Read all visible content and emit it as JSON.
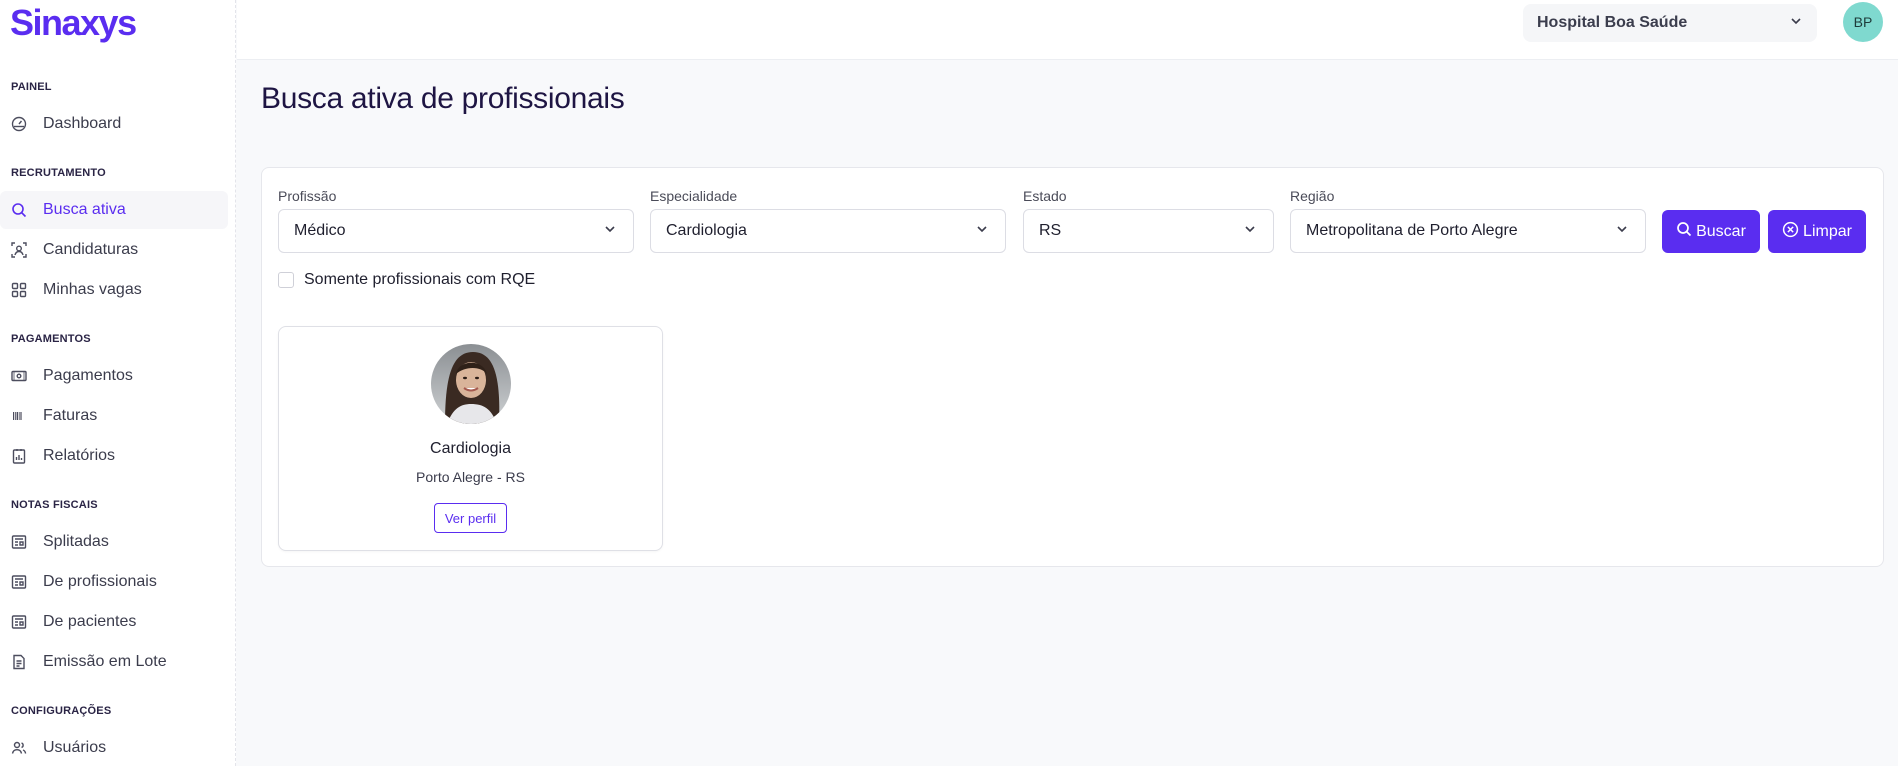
{
  "app": {
    "logo": "Sinaxys",
    "brand_color": "#5a2df0"
  },
  "sidebar": {
    "sections": [
      {
        "title": "PAINEL",
        "items": [
          {
            "label": "Dashboard",
            "icon": "dashboard-gauge-icon"
          }
        ]
      },
      {
        "title": "RECRUTAMENTO",
        "items": [
          {
            "label": "Busca ativa",
            "icon": "search-icon",
            "active": true
          },
          {
            "label": "Candidaturas",
            "icon": "candidates-icon"
          },
          {
            "label": "Minhas vagas",
            "icon": "grid-icon"
          }
        ]
      },
      {
        "title": "PAGAMENTOS",
        "items": [
          {
            "label": "Pagamentos",
            "icon": "cash-icon"
          },
          {
            "label": "Faturas",
            "icon": "barcode-icon"
          },
          {
            "label": "Relatórios",
            "icon": "report-icon"
          }
        ]
      },
      {
        "title": "NOTAS FISCAIS",
        "items": [
          {
            "label": "Splitadas",
            "icon": "newspaper-icon"
          },
          {
            "label": "De profissionais",
            "icon": "newspaper-icon"
          },
          {
            "label": "De pacientes",
            "icon": "newspaper-icon"
          },
          {
            "label": "Emissão em Lote",
            "icon": "document-icon"
          }
        ]
      },
      {
        "title": "CONFIGURAÇÕES",
        "items": [
          {
            "label": "Usuários",
            "icon": "users-icon"
          }
        ]
      }
    ]
  },
  "topbar": {
    "hospital": "Hospital Boa Saúde",
    "user_initials": "BP"
  },
  "main": {
    "title": "Busca ativa de profissionais",
    "filters": {
      "profissao": {
        "label": "Profissão",
        "value": "Médico"
      },
      "especialidade": {
        "label": "Especialidade",
        "value": "Cardiologia"
      },
      "estado": {
        "label": "Estado",
        "value": "RS"
      },
      "regiao": {
        "label": "Região",
        "value": "Metropolitana de Porto Alegre"
      }
    },
    "buttons": {
      "search": "Buscar",
      "clear": "Limpar"
    },
    "rqe_checkbox": {
      "label": "Somente profissionais com RQE",
      "checked": false
    },
    "results": [
      {
        "specialty": "Cardiologia",
        "location": "Porto Alegre - RS",
        "action": "Ver perfil"
      }
    ]
  }
}
